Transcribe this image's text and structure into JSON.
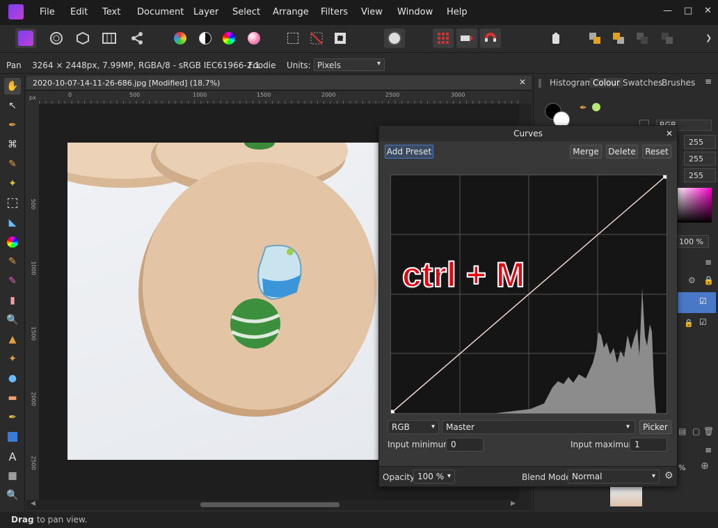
{
  "menu": [
    "File",
    "Edit",
    "Text",
    "Document",
    "Layer",
    "Select",
    "Arrange",
    "Filters",
    "View",
    "Window",
    "Help"
  ],
  "context": {
    "tool": "Pan",
    "info": "3264 × 2448px, 7.99MP, RGBA/8 - sRGB IEC61966-2.1",
    "profile": "Foodie",
    "units_label": "Units:",
    "units_value": "Pixels"
  },
  "document": {
    "tab_title": "2020-10-07-14-11-26-686.jpg [Modified] (18.7%)",
    "ruler_unit": "px",
    "ruler_h": [
      "0",
      "500",
      "1000",
      "1500",
      "2000",
      "2500",
      "3000"
    ],
    "ruler_v": [
      "500",
      "1000",
      "1500",
      "2000",
      "2500"
    ]
  },
  "right_panel": {
    "tabs": [
      "Histogram",
      "Colour",
      "Swatches",
      "Brushes"
    ],
    "active_tab": "Colour",
    "color_model": "RGB",
    "channels": [
      "255",
      "255",
      "255"
    ],
    "opacity_value": "100 %",
    "zoom_value": "%"
  },
  "curves": {
    "title": "Curves",
    "add_preset": "Add Preset",
    "merge": "Merge",
    "delete": "Delete",
    "reset": "Reset",
    "overlay_text": "ctrl + M",
    "channel": "RGB",
    "mode": "Master",
    "picker": "Picker",
    "input_min_label": "Input minimum:",
    "input_min": "0",
    "input_max_label": "Input maximum:",
    "input_max": "1",
    "opacity_label": "Opacity:",
    "opacity": "100 %",
    "blend_label": "Blend Mode:",
    "blend": "Normal"
  },
  "status": {
    "bold": "Drag",
    "rest": " to pan view."
  },
  "colors": {
    "accent": "#4a78c8",
    "overlay_red": "#e8000f"
  }
}
